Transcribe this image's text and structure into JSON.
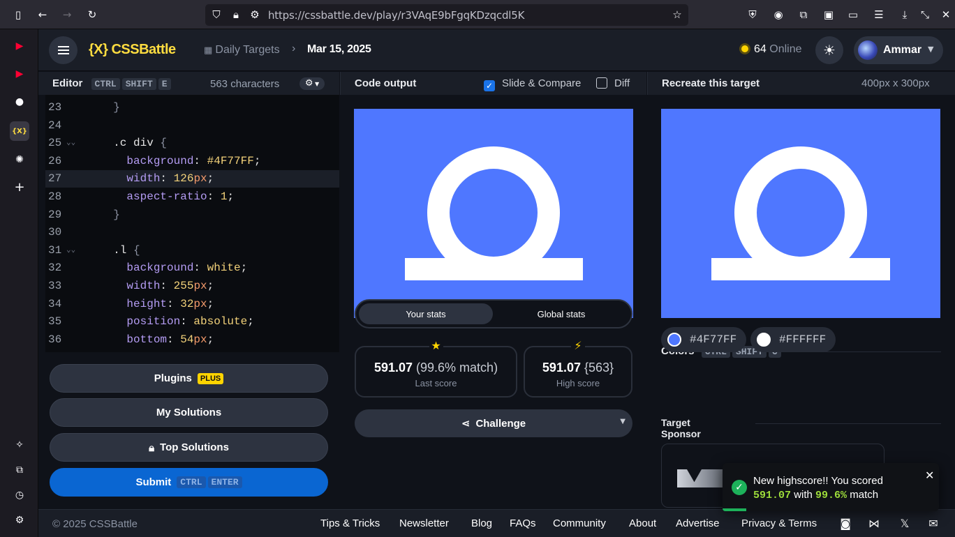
{
  "browser": {
    "url": "https://cssbattle.dev/play/r3VAqE9bFgqKDzqcdl5K"
  },
  "header": {
    "logo": "{X} CSSBattle",
    "breadcrumb_daily": "Daily Targets",
    "breadcrumb_date": "Mar 15, 2025",
    "online_count": "64",
    "online_label": "Online",
    "user_name": "Ammar"
  },
  "editor": {
    "title": "Editor",
    "shortcut": [
      "CTRL",
      "SHIFT",
      "E"
    ],
    "char_count": "563 characters",
    "lines": [
      {
        "n": "23",
        "fold": "",
        "code": "  }"
      },
      {
        "n": "24",
        "fold": "",
        "code": ""
      },
      {
        "n": "25",
        "fold": "⌄⌄",
        "code": "  .c div {"
      },
      {
        "n": "26",
        "fold": "",
        "code": "    background: #4F77FF;"
      },
      {
        "n": "27",
        "fold": "",
        "code": "    width: 126px;"
      },
      {
        "n": "28",
        "fold": "",
        "code": "    aspect-ratio: 1;"
      },
      {
        "n": "29",
        "fold": "",
        "code": "  }"
      },
      {
        "n": "30",
        "fold": "",
        "code": ""
      },
      {
        "n": "31",
        "fold": "⌄⌄",
        "code": "  .l {"
      },
      {
        "n": "32",
        "fold": "",
        "code": "    background: white;"
      },
      {
        "n": "33",
        "fold": "",
        "code": "    width: 255px;"
      },
      {
        "n": "34",
        "fold": "",
        "code": "    height: 32px;"
      },
      {
        "n": "35",
        "fold": "",
        "code": "    position: absolute;"
      },
      {
        "n": "36",
        "fold": "",
        "code": "    bottom: 54px;"
      }
    ],
    "plugins_label": "Plugins",
    "plugins_badge": "PLUS",
    "my_solutions_label": "My Solutions",
    "top_solutions_label": "Top Solutions",
    "submit_label": "Submit",
    "submit_shortcut": [
      "CTRL",
      "ENTER"
    ]
  },
  "output": {
    "title": "Code output",
    "slide_compare_label": "Slide & Compare",
    "slide_compare_checked": true,
    "diff_label": "Diff",
    "diff_checked": false,
    "tab_your_stats": "Your stats",
    "tab_global_stats": "Global stats",
    "last_score": "591.07",
    "last_match": "(99.6% match)",
    "last_score_label": "Last score",
    "high_score": "591.07",
    "high_chars": "{563}",
    "high_score_label": "High score",
    "challenge_label": "Challenge"
  },
  "target": {
    "title": "Recreate this target",
    "size": "400px x 300px",
    "colors_title": "Colors",
    "colors_shortcut": [
      "CTRL",
      "SHIFT",
      "C"
    ],
    "colors": [
      "#4F77FF",
      "#FFFFFF"
    ],
    "sponsor_title": "Target Sponsor"
  },
  "footer": {
    "copyright": "© 2025 CSSBattle",
    "links": [
      "Tips & Tricks",
      "Newsletter",
      "Blog",
      "FAQs",
      "Community",
      "About",
      "Advertise",
      "Privacy & Terms"
    ]
  },
  "toast": {
    "line1": "New highscore!! You scored",
    "score": "591.07",
    "with": "with",
    "match": "99.6%",
    "suffix": "match"
  },
  "colors": {
    "canvas_blue": "#4F77FF",
    "accent_yellow": "#FFD400",
    "submit_blue": "#0A66D2"
  }
}
